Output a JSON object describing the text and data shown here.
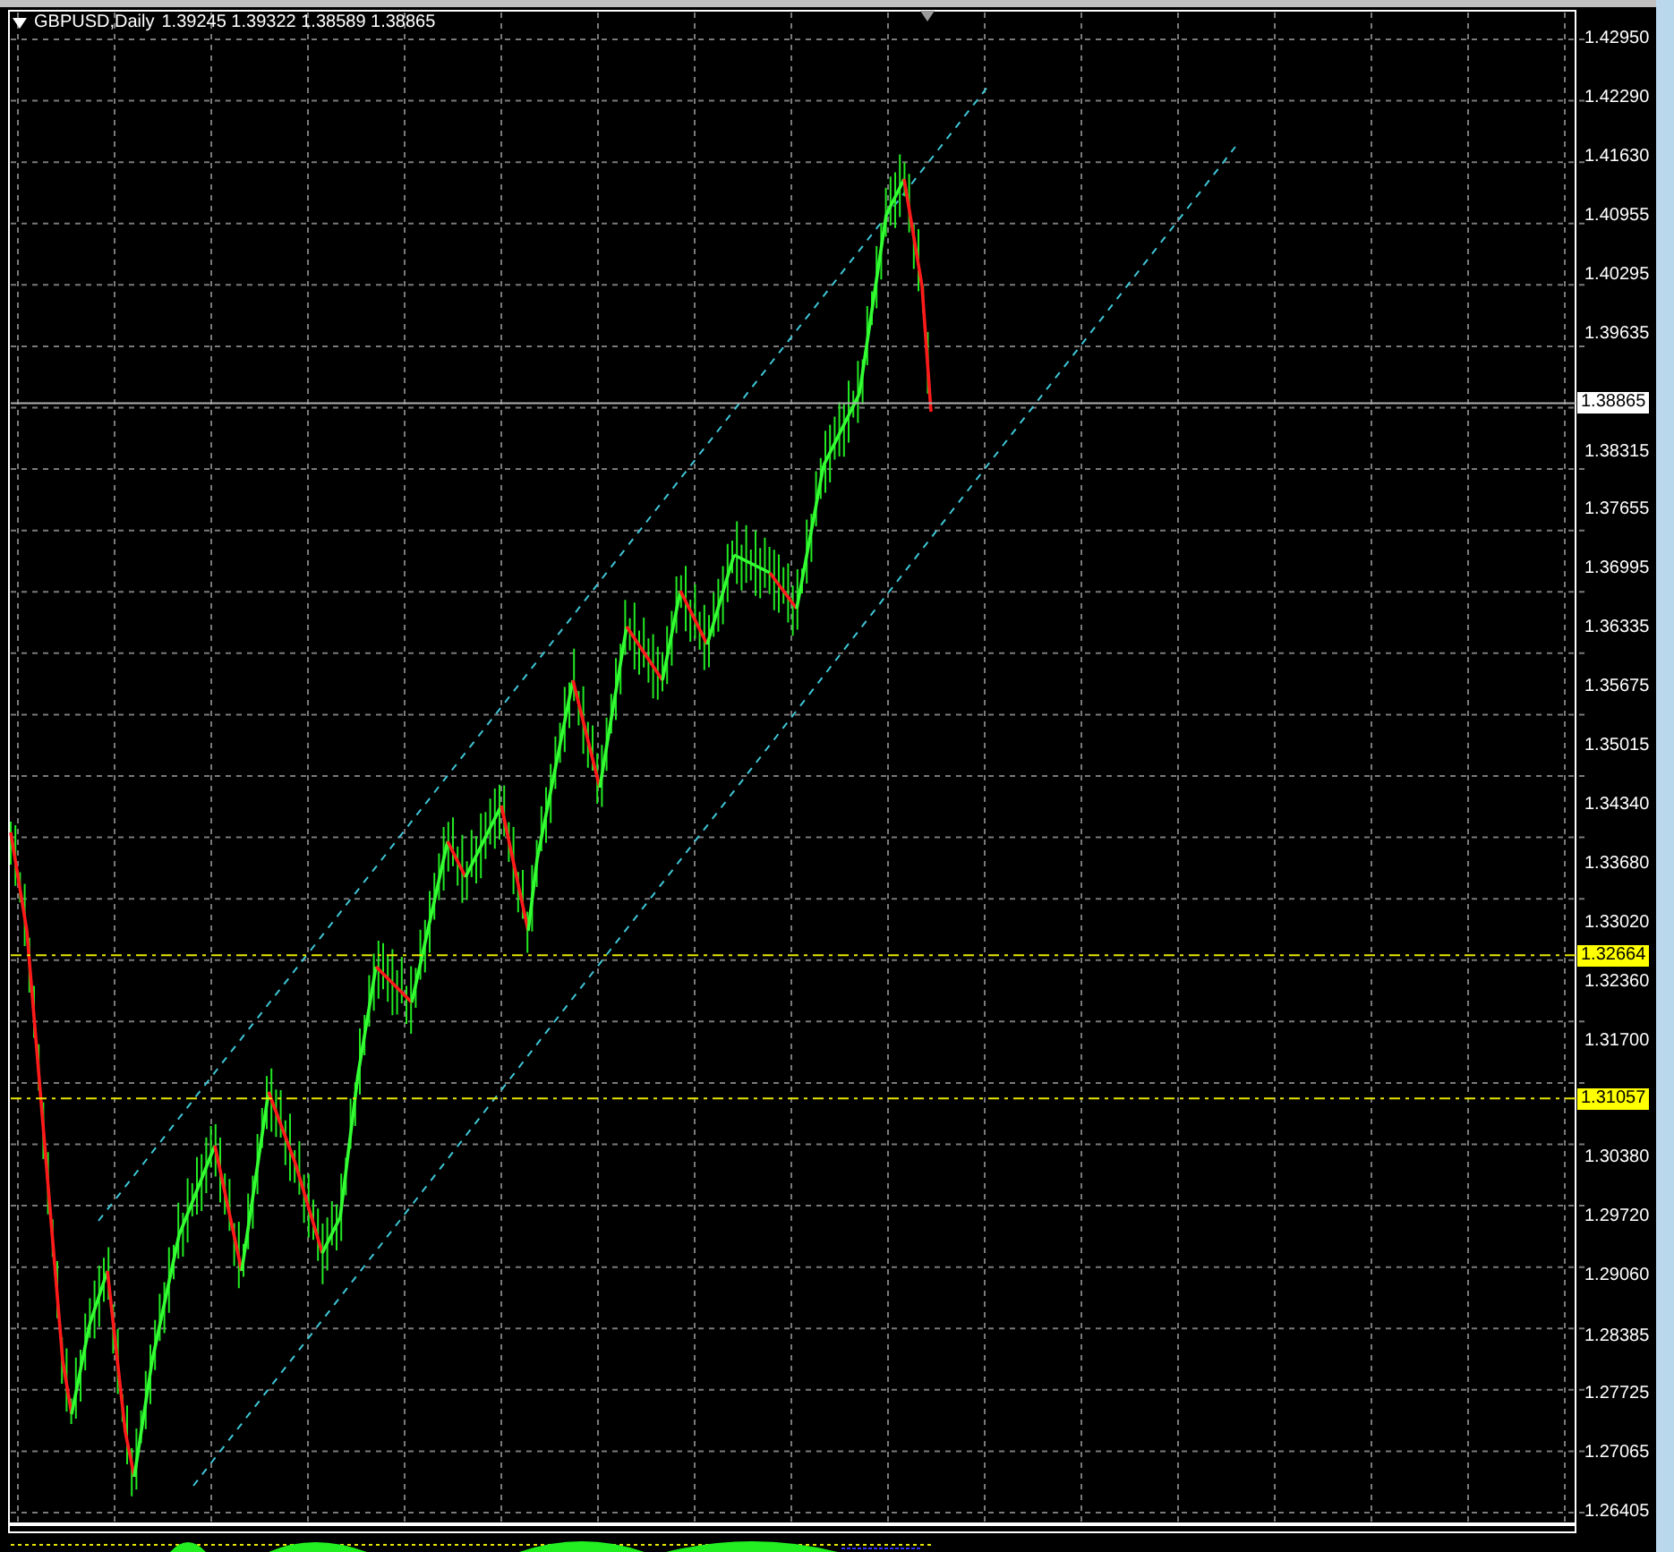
{
  "chart_header": {
    "symbol": "GBPUSD,Daily",
    "ohlc": "1.39245 1.39322 1.38589 1.38865"
  },
  "price_axis": {
    "labels": [
      "1.42950",
      "1.42290",
      "1.41630",
      "1.40955",
      "1.40295",
      "1.39635",
      "1.38315",
      "1.37655",
      "1.36995",
      "1.36335",
      "1.35675",
      "1.35015",
      "1.34340",
      "1.33680",
      "1.33020",
      "1.32360",
      "1.31700",
      "1.30380",
      "1.29720",
      "1.29060",
      "1.28385",
      "1.27725",
      "1.27065",
      "1.26405"
    ]
  },
  "bid_marker": {
    "price": "1.38865"
  },
  "price_levels": [
    {
      "price": "1.32664"
    },
    {
      "price": "1.31057"
    }
  ]
}
